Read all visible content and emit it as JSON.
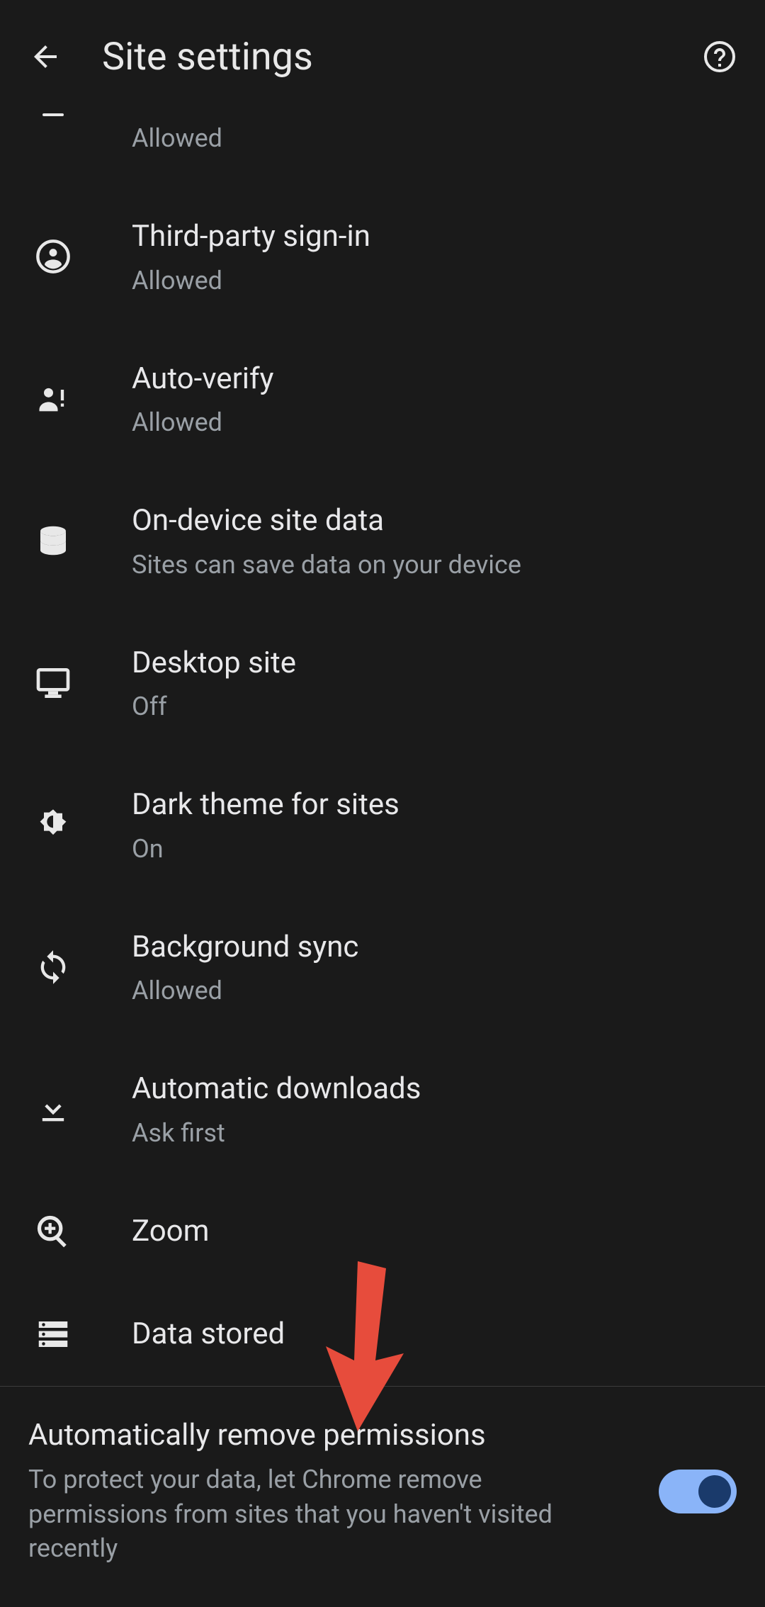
{
  "header": {
    "title": "Site settings"
  },
  "rows": {
    "r0": {
      "sub": "Allowed"
    },
    "r1": {
      "label": "Third-party sign-in",
      "sub": "Allowed"
    },
    "r2": {
      "label": "Auto-verify",
      "sub": "Allowed"
    },
    "r3": {
      "label": "On-device site data",
      "sub": "Sites can save data on your device"
    },
    "r4": {
      "label": "Desktop site",
      "sub": "Off"
    },
    "r5": {
      "label": "Dark theme for sites",
      "sub": "On"
    },
    "r6": {
      "label": "Background sync",
      "sub": "Allowed"
    },
    "r7": {
      "label": "Automatic downloads",
      "sub": "Ask first"
    },
    "r8": {
      "label": "Zoom"
    },
    "r9": {
      "label": "Data stored"
    }
  },
  "bottom": {
    "title": "Automatically remove permissions",
    "sub": "To protect your data, let Chrome remove permissions from sites that you haven't visited recently",
    "toggle_on": true
  }
}
